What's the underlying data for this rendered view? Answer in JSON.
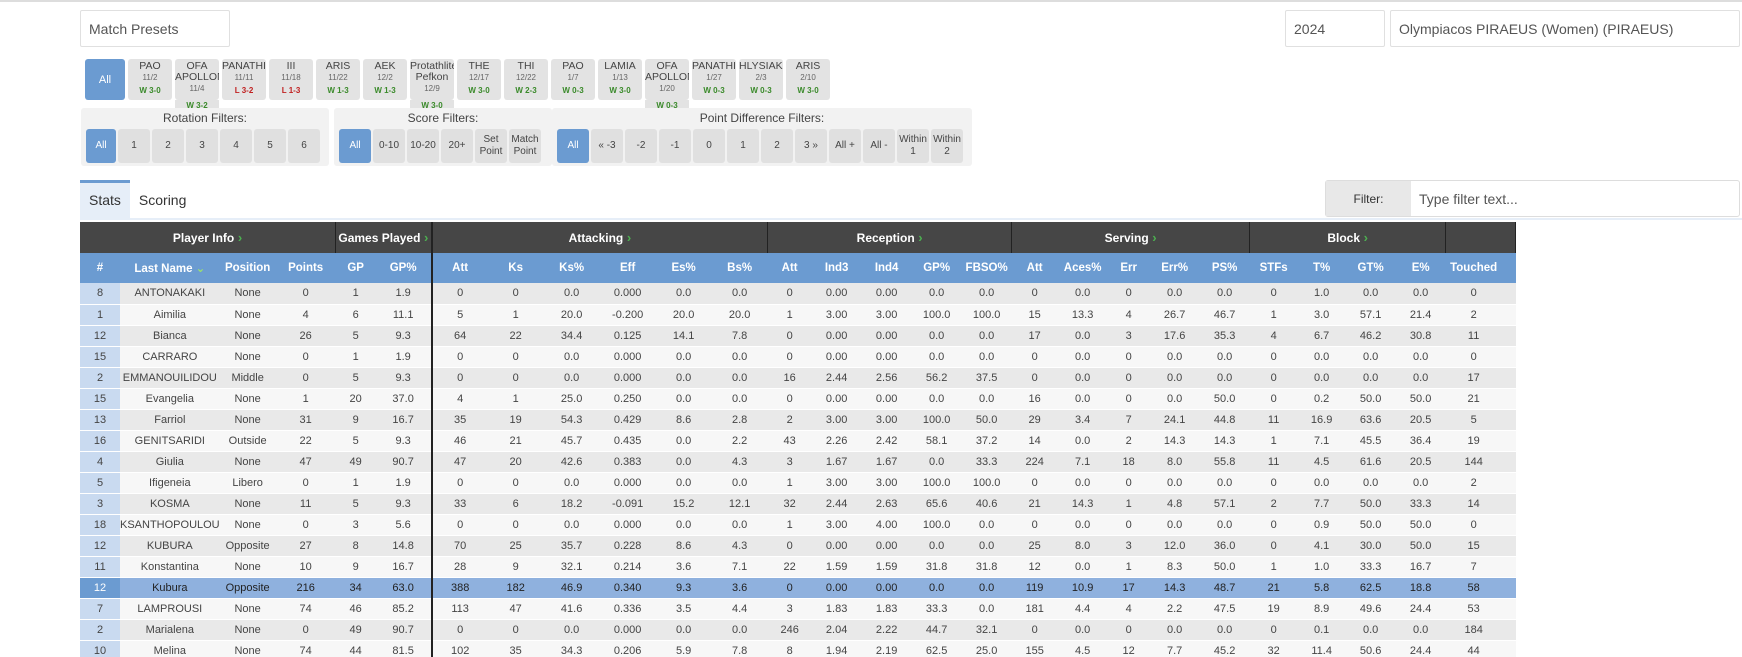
{
  "toolbar": {
    "match_presets": "Match Presets",
    "year": "2024",
    "team": "Olympiacos PIRAEUS (Women) (PIRAEUS)"
  },
  "matches": [
    {
      "opp": "All",
      "date": "",
      "res": "",
      "type": "all"
    },
    {
      "opp": "PAO",
      "date": "11/2",
      "res": "W 3-0",
      "type": "win"
    },
    {
      "opp": "OFA APOLLON",
      "date": "11/4",
      "res": "W 3-2",
      "type": "win"
    },
    {
      "opp": "PANATHIN",
      "date": "11/11",
      "res": "L 3-2",
      "type": "loss"
    },
    {
      "opp": "III",
      "date": "11/18",
      "res": "L 1-3",
      "type": "loss"
    },
    {
      "opp": "ARIS",
      "date": "11/22",
      "res": "W 1-3",
      "type": "win"
    },
    {
      "opp": "AEK",
      "date": "12/2",
      "res": "W 1-3",
      "type": "win"
    },
    {
      "opp": "Protathlite Pefkon",
      "date": "12/9",
      "res": "W 3-0",
      "type": "win"
    },
    {
      "opp": "THE",
      "date": "12/17",
      "res": "W 3-0",
      "type": "win"
    },
    {
      "opp": "THI",
      "date": "12/22",
      "res": "W 2-3",
      "type": "win"
    },
    {
      "opp": "PAO",
      "date": "1/7",
      "res": "W 0-3",
      "type": "win"
    },
    {
      "opp": "LAMIA",
      "date": "1/13",
      "res": "W 3-0",
      "type": "win"
    },
    {
      "opp": "OFA APOLLON",
      "date": "1/20",
      "res": "W 0-3",
      "type": "win"
    },
    {
      "opp": "PANATHIN",
      "date": "1/27",
      "res": "W 0-3",
      "type": "win"
    },
    {
      "opp": "HLYSIAKO",
      "date": "2/3",
      "res": "W 0-3",
      "type": "win"
    },
    {
      "opp": "ARIS",
      "date": "2/10",
      "res": "W 3-0",
      "type": "win"
    }
  ],
  "rotation": {
    "title": "Rotation Filters:",
    "buttons": [
      "All",
      "1",
      "2",
      "3",
      "4",
      "5",
      "6"
    ]
  },
  "score": {
    "title": "Score Filters:",
    "buttons": [
      "All",
      "0-10",
      "10-20",
      "20+",
      "Set Point",
      "Match Point"
    ]
  },
  "pointdiff": {
    "title": "Point Difference Filters:",
    "buttons": [
      "All",
      "« -3",
      "-2",
      "-1",
      "0",
      "1",
      "2",
      "3 »",
      "All +",
      "All -",
      "Within 1",
      "Within 2"
    ]
  },
  "tabs": [
    "Stats",
    "Scoring"
  ],
  "filter": {
    "label": "Filter:",
    "placeholder": "Type filter text..."
  },
  "groups": [
    "Player Info",
    "Games Played",
    "Attacking",
    "Reception",
    "Serving",
    "Block",
    ""
  ],
  "columns": [
    "#",
    "Last Name",
    "Position",
    "Points",
    "GP",
    "GP%",
    "Att",
    "Ks",
    "Ks%",
    "Eff",
    "Es%",
    "Bs%",
    "Att",
    "Ind3",
    "Ind4",
    "GP%",
    "FBSO%",
    "Att",
    "Aces%",
    "Err",
    "Err%",
    "PS%",
    "STFs",
    "T%",
    "GT%",
    "E%",
    "Touched",
    ""
  ],
  "rows": [
    [
      "8",
      "ANTONAKAKI",
      "None",
      "0",
      "1",
      "1.9",
      "0",
      "0",
      "0.0",
      "0.000",
      "0.0",
      "0.0",
      "0",
      "0.00",
      "0.00",
      "0.0",
      "0.0",
      "0",
      "0.0",
      "0",
      "0.0",
      "0.0",
      "0",
      "1.0",
      "0.0",
      "0.0",
      "0"
    ],
    [
      "1",
      "Aimilia",
      "None",
      "4",
      "6",
      "11.1",
      "5",
      "1",
      "20.0",
      "-0.200",
      "20.0",
      "20.0",
      "1",
      "3.00",
      "3.00",
      "100.0",
      "100.0",
      "15",
      "13.3",
      "4",
      "26.7",
      "46.7",
      "1",
      "3.0",
      "57.1",
      "21.4",
      "2"
    ],
    [
      "12",
      "Bianca",
      "None",
      "26",
      "5",
      "9.3",
      "64",
      "22",
      "34.4",
      "0.125",
      "14.1",
      "7.8",
      "0",
      "0.00",
      "0.00",
      "0.0",
      "0.0",
      "17",
      "0.0",
      "3",
      "17.6",
      "35.3",
      "4",
      "6.7",
      "46.2",
      "30.8",
      "11"
    ],
    [
      "15",
      "CARRARO",
      "None",
      "0",
      "1",
      "1.9",
      "0",
      "0",
      "0.0",
      "0.000",
      "0.0",
      "0.0",
      "0",
      "0.00",
      "0.00",
      "0.0",
      "0.0",
      "0",
      "0.0",
      "0",
      "0.0",
      "0.0",
      "0",
      "0.0",
      "0.0",
      "0.0",
      "0"
    ],
    [
      "2",
      "EMMANOUILIDOU",
      "Middle",
      "0",
      "5",
      "9.3",
      "0",
      "0",
      "0.0",
      "0.000",
      "0.0",
      "0.0",
      "16",
      "2.44",
      "2.56",
      "56.2",
      "37.5",
      "0",
      "0.0",
      "0",
      "0.0",
      "0.0",
      "0",
      "0.0",
      "0.0",
      "0.0",
      "17"
    ],
    [
      "15",
      "Evangelia",
      "None",
      "1",
      "20",
      "37.0",
      "4",
      "1",
      "25.0",
      "0.250",
      "0.0",
      "0.0",
      "0",
      "0.00",
      "0.00",
      "0.0",
      "0.0",
      "16",
      "0.0",
      "0",
      "0.0",
      "50.0",
      "0",
      "0.2",
      "50.0",
      "50.0",
      "21"
    ],
    [
      "13",
      "Farriol",
      "None",
      "31",
      "9",
      "16.7",
      "35",
      "19",
      "54.3",
      "0.429",
      "8.6",
      "2.8",
      "2",
      "3.00",
      "3.00",
      "100.0",
      "50.0",
      "29",
      "3.4",
      "7",
      "24.1",
      "44.8",
      "11",
      "16.9",
      "63.6",
      "20.5",
      "5"
    ],
    [
      "16",
      "GENITSARIDI",
      "Outside",
      "22",
      "5",
      "9.3",
      "46",
      "21",
      "45.7",
      "0.435",
      "0.0",
      "2.2",
      "43",
      "2.26",
      "2.42",
      "58.1",
      "37.2",
      "14",
      "0.0",
      "2",
      "14.3",
      "14.3",
      "1",
      "7.1",
      "45.5",
      "36.4",
      "19"
    ],
    [
      "4",
      "Giulia",
      "None",
      "47",
      "49",
      "90.7",
      "47",
      "20",
      "42.6",
      "0.383",
      "0.0",
      "4.3",
      "3",
      "1.67",
      "1.67",
      "0.0",
      "33.3",
      "224",
      "7.1",
      "18",
      "8.0",
      "55.8",
      "11",
      "4.5",
      "61.6",
      "20.5",
      "144"
    ],
    [
      "5",
      "Ifigeneia",
      "Libero",
      "0",
      "1",
      "1.9",
      "0",
      "0",
      "0.0",
      "0.000",
      "0.0",
      "0.0",
      "1",
      "3.00",
      "3.00",
      "100.0",
      "100.0",
      "0",
      "0.0",
      "0",
      "0.0",
      "0.0",
      "0",
      "0.0",
      "0.0",
      "0.0",
      "2"
    ],
    [
      "3",
      "KOSMA",
      "None",
      "11",
      "5",
      "9.3",
      "33",
      "6",
      "18.2",
      "-0.091",
      "15.2",
      "12.1",
      "32",
      "2.44",
      "2.63",
      "65.6",
      "40.6",
      "21",
      "14.3",
      "1",
      "4.8",
      "57.1",
      "2",
      "7.7",
      "50.0",
      "33.3",
      "14"
    ],
    [
      "18",
      "KSANTHOPOULOU",
      "None",
      "0",
      "3",
      "5.6",
      "0",
      "0",
      "0.0",
      "0.000",
      "0.0",
      "0.0",
      "1",
      "3.00",
      "4.00",
      "100.0",
      "0.0",
      "0",
      "0.0",
      "0",
      "0.0",
      "0.0",
      "0",
      "0.9",
      "50.0",
      "50.0",
      "0"
    ],
    [
      "12",
      "KUBURA",
      "Opposite",
      "27",
      "8",
      "14.8",
      "70",
      "25",
      "35.7",
      "0.228",
      "8.6",
      "4.3",
      "0",
      "0.00",
      "0.00",
      "0.0",
      "0.0",
      "25",
      "8.0",
      "3",
      "12.0",
      "36.0",
      "0",
      "4.1",
      "30.0",
      "50.0",
      "15"
    ],
    [
      "11",
      "Konstantina",
      "None",
      "10",
      "9",
      "16.7",
      "28",
      "9",
      "32.1",
      "0.214",
      "3.6",
      "7.1",
      "22",
      "1.59",
      "1.59",
      "31.8",
      "31.8",
      "12",
      "0.0",
      "1",
      "8.3",
      "50.0",
      "1",
      "1.0",
      "33.3",
      "16.7",
      "7"
    ],
    [
      "12",
      "Kubura",
      "Opposite",
      "216",
      "34",
      "63.0",
      "388",
      "182",
      "46.9",
      "0.340",
      "9.3",
      "3.6",
      "0",
      "0.00",
      "0.00",
      "0.0",
      "0.0",
      "119",
      "10.9",
      "17",
      "14.3",
      "48.7",
      "21",
      "5.8",
      "62.5",
      "18.8",
      "58"
    ],
    [
      "7",
      "LAMPROUSI",
      "None",
      "74",
      "46",
      "85.2",
      "113",
      "47",
      "41.6",
      "0.336",
      "3.5",
      "4.4",
      "3",
      "1.83",
      "1.83",
      "33.3",
      "0.0",
      "181",
      "4.4",
      "4",
      "2.2",
      "47.5",
      "19",
      "8.9",
      "49.6",
      "24.4",
      "53"
    ],
    [
      "2",
      "Marialena",
      "None",
      "0",
      "49",
      "90.7",
      "0",
      "0",
      "0.0",
      "0.000",
      "0.0",
      "0.0",
      "246",
      "2.04",
      "2.22",
      "44.7",
      "32.1",
      "0",
      "0.0",
      "0",
      "0.0",
      "0.0",
      "0",
      "0.1",
      "0.0",
      "0.0",
      "184"
    ],
    [
      "10",
      "Melina",
      "None",
      "74",
      "44",
      "81.5",
      "102",
      "35",
      "34.3",
      "0.206",
      "5.9",
      "7.8",
      "8",
      "1.94",
      "2.19",
      "62.5",
      "25.0",
      "155",
      "4.5",
      "12",
      "7.7",
      "45.2",
      "32",
      "11.4",
      "50.6",
      "24.4",
      "44"
    ]
  ],
  "highlight_row": 14
}
